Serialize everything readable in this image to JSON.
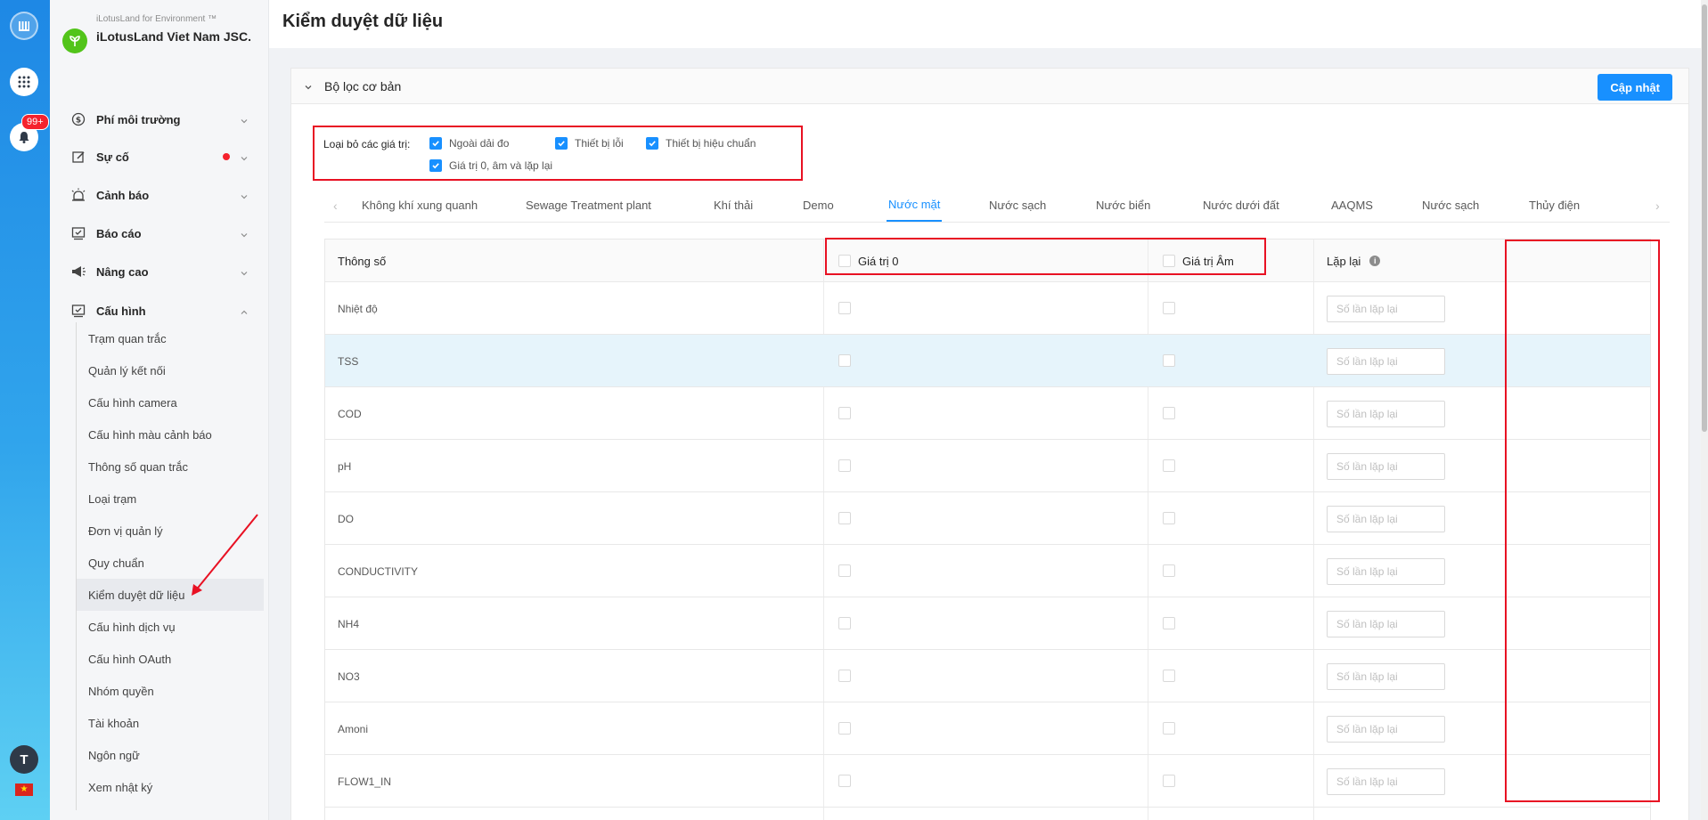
{
  "app": {
    "brand_sub": "iLotusLand for Environment ™",
    "brand_name": "iLotusLand Viet Nam JSC.",
    "notification_count": "99+",
    "user_initial": "T"
  },
  "sidebar": {
    "menu": [
      {
        "label": "Phí môi trường",
        "icon": "dollar-icon"
      },
      {
        "label": "Sự cố",
        "icon": "edit-icon"
      },
      {
        "label": "Cảnh báo",
        "icon": "alarm-icon"
      },
      {
        "label": "Báo cáo",
        "icon": "report-icon"
      },
      {
        "label": "Nâng cao",
        "icon": "megaphone-icon"
      },
      {
        "label": "Cấu hình",
        "icon": "config-icon"
      }
    ],
    "submenu": [
      "Trạm quan trắc",
      "Quản lý kết nối",
      "Cấu hình camera",
      "Cấu hình màu cảnh báo",
      "Thông số quan trắc",
      "Loại trạm",
      "Đơn vị quản lý",
      "Quy chuẩn",
      "Kiểm duyệt dữ liệu",
      "Cấu hình dịch vụ",
      "Cấu hình OAuth",
      "Nhóm quyền",
      "Tài khoản",
      "Ngôn ngữ",
      "Xem nhật ký"
    ],
    "active_submenu": "Kiểm duyệt dữ liệu"
  },
  "page": {
    "title": "Kiểm duyệt dữ liệu"
  },
  "filter": {
    "title": "Bộ lọc cơ bản",
    "update_button": "Cập nhật",
    "exclude_label": "Loại bỏ các giá trị:",
    "options": [
      {
        "label": "Ngoài dải đo",
        "checked": true
      },
      {
        "label": "Thiết bị lỗi",
        "checked": true
      },
      {
        "label": "Thiết bị hiệu chuẩn",
        "checked": true
      },
      {
        "label": "Giá trị 0, âm và lặp lại",
        "checked": true
      }
    ]
  },
  "tabs": [
    "Không khí xung quanh",
    "Sewage Treatment plant",
    "Khí thải",
    "Demo",
    "Nước mặt",
    "Nước sạch",
    "Nước biển",
    "Nước dưới đất",
    "AAQMS",
    "Nước sạch",
    "Thủy điện"
  ],
  "active_tab": "Nước mặt",
  "table": {
    "headers": {
      "param": "Thông số",
      "zero": "Giá trị 0",
      "negative": "Giá trị Âm",
      "repeat": "Lặp lại"
    },
    "repeat_placeholder": "Số lần lặp lại",
    "rows": [
      "Nhiệt độ",
      "TSS",
      "COD",
      "pH",
      "DO",
      "CONDUCTIVITY",
      "NH4",
      "NO3",
      "Amoni",
      "FLOW1_IN"
    ]
  },
  "colors": {
    "primary": "#1890ff",
    "annotation": "#e81123",
    "rail_top": "#1e88e5",
    "rail_bottom": "#5ed0f3"
  }
}
